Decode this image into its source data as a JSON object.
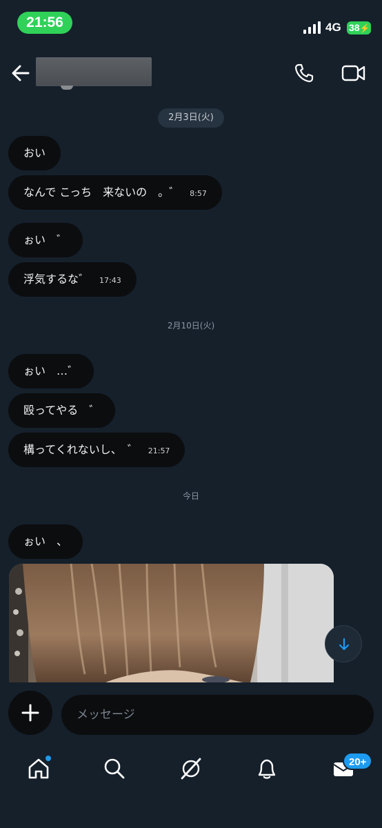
{
  "status_bar": {
    "time": "21:56",
    "network": "4G",
    "battery": "38"
  },
  "header": {
    "back_icon": "arrow-left-icon",
    "call_icon": "phone-icon",
    "video_icon": "video-camera-icon"
  },
  "dates": {
    "first": "2月3日(火)",
    "second": "2月10日(火)",
    "third": "今日"
  },
  "messages": [
    {
      "text": "おい",
      "time": ""
    },
    {
      "text": "なんで こっち　来ないの　。゛",
      "time": "8:57"
    },
    {
      "text": "ぉい　゛",
      "time": ""
    },
    {
      "text": "浮気するな゛",
      "time": "17:43"
    },
    {
      "text": "ぉい　…゛",
      "time": ""
    },
    {
      "text": "殴ってやる　゛",
      "time": ""
    },
    {
      "text": "構ってくれないし、　゛",
      "time": "21:57"
    },
    {
      "text": "ぉい　、",
      "time": ""
    }
  ],
  "composer": {
    "placeholder": "メッセージ"
  },
  "tab_bar": {
    "mail_badge": "20+"
  },
  "colors": {
    "background": "#15202b",
    "bubble": "#0c0d0f",
    "accent": "#1d9bf0",
    "status_green": "#30d158"
  }
}
